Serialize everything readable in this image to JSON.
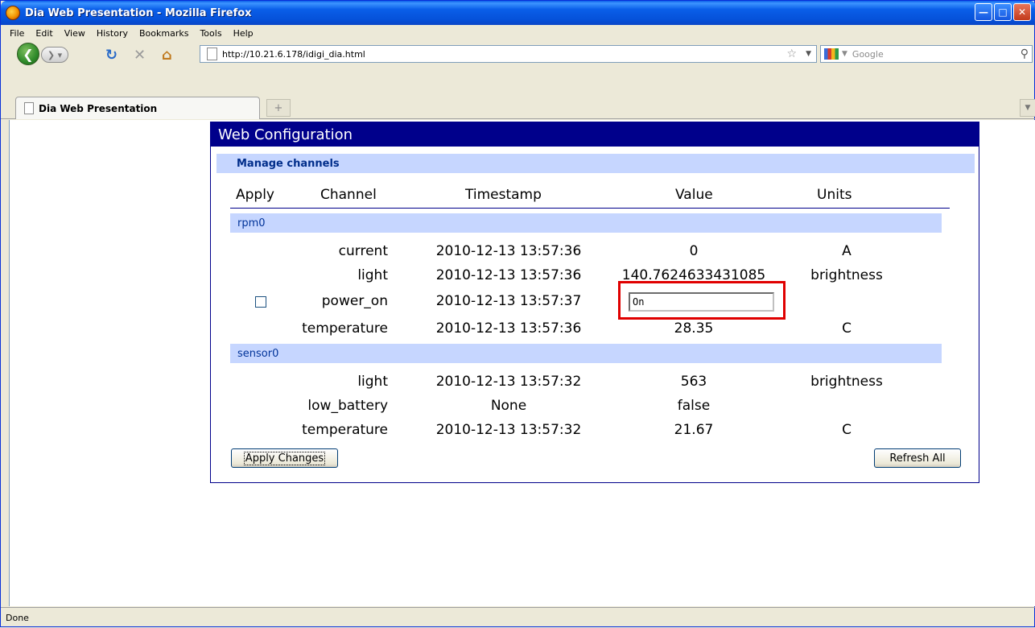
{
  "window": {
    "title": "Dia Web Presentation - Mozilla Firefox"
  },
  "menu": [
    "File",
    "Edit",
    "View",
    "History",
    "Bookmarks",
    "Tools",
    "Help"
  ],
  "nav": {
    "url": "http://10.21.6.178/idigi_dia.html",
    "search_placeholder": "Google"
  },
  "tab": {
    "label": "Dia Web Presentation"
  },
  "panel": {
    "title": "Web Configuration",
    "section": "Manage channels",
    "headers": {
      "apply": "Apply",
      "channel": "Channel",
      "timestamp": "Timestamp",
      "value": "Value",
      "units": "Units"
    },
    "groups": [
      {
        "name": "rpm0",
        "rows": [
          {
            "channel": "current",
            "timestamp": "2010-12-13 13:57:36",
            "value": "0",
            "units": "A"
          },
          {
            "channel": "light",
            "timestamp": "2010-12-13 13:57:36",
            "value": "140.7624633431085",
            "units": "brightness"
          },
          {
            "channel": "power_on",
            "timestamp": "2010-12-13 13:57:37",
            "value": "On",
            "units": ""
          },
          {
            "channel": "temperature",
            "timestamp": "2010-12-13 13:57:36",
            "value": "28.35",
            "units": "C"
          }
        ]
      },
      {
        "name": "sensor0",
        "rows": [
          {
            "channel": "light",
            "timestamp": "2010-12-13 13:57:32",
            "value": "563",
            "units": "brightness"
          },
          {
            "channel": "low_battery",
            "timestamp": "None",
            "value": "false",
            "units": ""
          },
          {
            "channel": "temperature",
            "timestamp": "2010-12-13 13:57:32",
            "value": "21.67",
            "units": "C"
          }
        ]
      }
    ],
    "apply_button": "Apply Changes",
    "refresh_button": "Refresh All"
  },
  "status": {
    "text": "Done"
  }
}
